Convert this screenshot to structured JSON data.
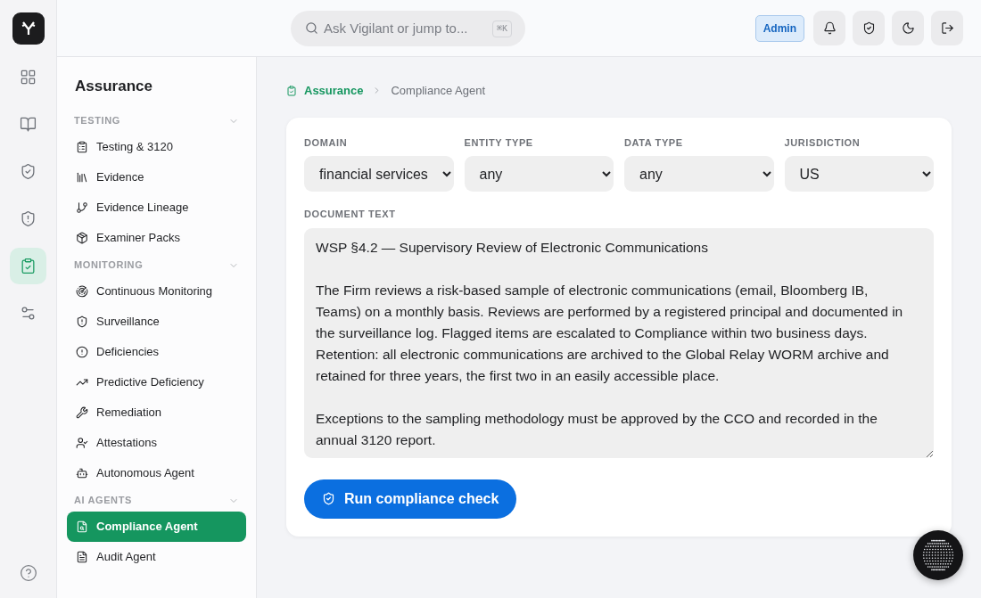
{
  "rail": {
    "items": [
      {
        "selected": false
      },
      {
        "selected": false
      },
      {
        "selected": false
      },
      {
        "selected": false
      },
      {
        "selected": true
      },
      {
        "selected": false
      }
    ]
  },
  "header": {
    "search": {
      "placeholder": "Ask Vigilant or jump to...",
      "shortcut": "⌘K"
    },
    "role_badge": "Admin"
  },
  "sidebar": {
    "title": "Assurance",
    "sections": [
      {
        "title": "TESTING",
        "expanded": true,
        "items": [
          {
            "label": "Testing & 3120",
            "selected": false
          },
          {
            "label": "Evidence",
            "selected": false
          },
          {
            "label": "Evidence Lineage",
            "selected": false
          },
          {
            "label": "Examiner Packs",
            "selected": false
          }
        ]
      },
      {
        "title": "MONITORING",
        "expanded": true,
        "items": [
          {
            "label": "Continuous Monitoring",
            "selected": false
          },
          {
            "label": "Surveillance",
            "selected": false
          },
          {
            "label": "Deficiencies",
            "selected": false
          },
          {
            "label": "Predictive Deficiency",
            "selected": false
          },
          {
            "label": "Remediation",
            "selected": false
          },
          {
            "label": "Attestations",
            "selected": false
          },
          {
            "label": "Autonomous Agent",
            "selected": false
          }
        ]
      },
      {
        "title": "AI AGENTS",
        "expanded": true,
        "items": [
          {
            "label": "Compliance Agent",
            "selected": true
          },
          {
            "label": "Audit Agent",
            "selected": false
          }
        ]
      }
    ]
  },
  "breadcrumb": [
    "Assurance",
    "Compliance Agent"
  ],
  "form": {
    "filters": [
      {
        "label": "DOMAIN",
        "value": "financial services"
      },
      {
        "label": "ENTITY TYPE",
        "value": "any"
      },
      {
        "label": "DATA TYPE",
        "value": "any"
      },
      {
        "label": "JURISDICTION",
        "value": "US"
      }
    ],
    "document_label": "DOCUMENT TEXT",
    "document_text": "WSP §4.2 — Supervisory Review of Electronic Communications\n\nThe Firm reviews a risk-based sample of electronic communications (email, Bloomberg IB, Teams) on a monthly basis. Reviews are performed by a registered principal and documented in the surveillance log. Flagged items are escalated to Compliance within two business days. Retention: all electronic communications are archived to the Global Relay WORM archive and retained for three years, the first two in an easily accessible place.\n\nExceptions to the sampling methodology must be approved by the CCO and recorded in the annual 3120 report.",
    "submit": "Run compliance check"
  }
}
